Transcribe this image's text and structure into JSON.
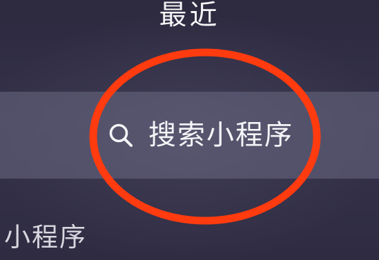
{
  "header": {
    "title": "最近"
  },
  "search": {
    "icon": "search-icon",
    "label": "搜索小程序"
  },
  "section": {
    "title": "小程序"
  },
  "annotation": {
    "ring_color": "#ff3b0f"
  },
  "colors": {
    "background": "#2f2c42",
    "search_bar": "#5a5873",
    "text": "#f5f5f8"
  }
}
